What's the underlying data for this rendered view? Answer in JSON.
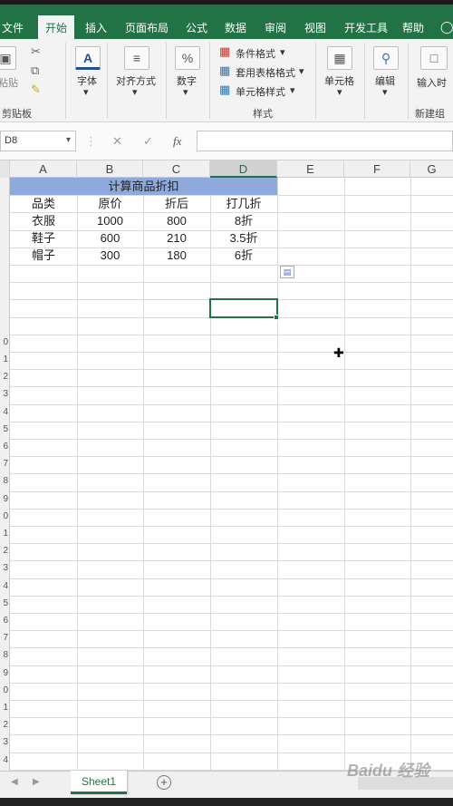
{
  "ribbon_tabs": [
    "文件",
    "开始",
    "插入",
    "页面布局",
    "公式",
    "数据",
    "审阅",
    "视图",
    "开发工具",
    "帮助"
  ],
  "ribbon": {
    "clipboard_paste": "粘贴",
    "clipboard_group": "剪贴板",
    "font_label": "字体",
    "align_label": "对齐方式",
    "number_label": "数字",
    "cond_format": "条件格式",
    "table_format": "套用表格格式",
    "cell_style": "单元格样式",
    "styles_group": "样式",
    "cells_label": "单元格",
    "edit_label": "编辑",
    "input_label": "输入时",
    "new_group": "新建组"
  },
  "formula_bar": {
    "name_box": "D8",
    "fx": "fx",
    "formula": ""
  },
  "columns": [
    "A",
    "B",
    "C",
    "D",
    "E",
    "F",
    "G"
  ],
  "selected_column": "D",
  "sheet": {
    "title": "计算商品折扣",
    "headers": [
      "品类",
      "原价",
      "折后",
      "打几折"
    ],
    "rows": [
      [
        "衣服",
        "1000",
        "800",
        "8折"
      ],
      [
        "鞋子",
        "600",
        "210",
        "3.5折"
      ],
      [
        "帽子",
        "300",
        "180",
        "6折"
      ]
    ]
  },
  "row_numbers": [
    "",
    "",
    "",
    "",
    "",
    "",
    "",
    "",
    "",
    "0",
    "1",
    "2",
    "3",
    "4",
    "5",
    "6",
    "7",
    "8",
    "9",
    "0",
    "1",
    "2",
    "3",
    "4",
    "5",
    "6",
    "7",
    "8",
    "9",
    "0",
    "1",
    "2",
    "3",
    "4"
  ],
  "sheet_tabs": [
    "Sheet1"
  ],
  "watermark": "Baidu 经验",
  "colors": {
    "excel_green": "#217346",
    "title_fill": "#8ea9db"
  }
}
